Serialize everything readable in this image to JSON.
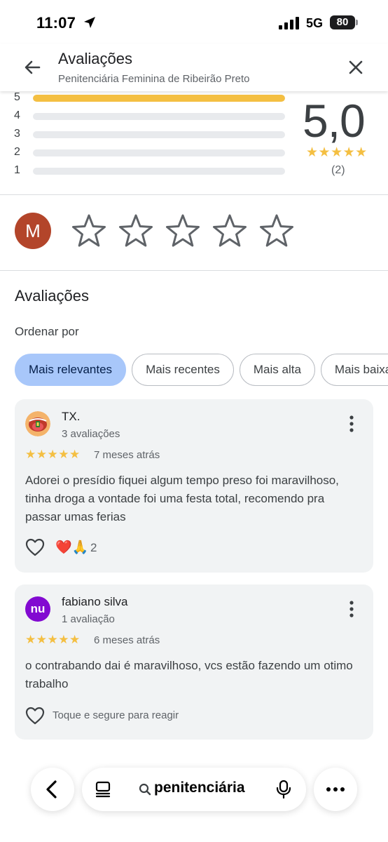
{
  "status_bar": {
    "time": "11:07",
    "network": "5G",
    "battery": "80"
  },
  "header": {
    "title": "Avaliações",
    "subtitle": "Penitenciária Feminina de Ribeirão Preto"
  },
  "rating_summary": {
    "average": "5,0",
    "stars": "★★★★★",
    "count": "(2)",
    "histogram": [
      {
        "label": "5",
        "fraction": 1.0
      },
      {
        "label": "4",
        "fraction": 0
      },
      {
        "label": "3",
        "fraction": 0
      },
      {
        "label": "2",
        "fraction": 0
      },
      {
        "label": "1",
        "fraction": 0
      }
    ]
  },
  "user": {
    "avatar_initial": "M",
    "avatar_color": "#b3452a"
  },
  "reviews_section": {
    "title": "Avaliações",
    "sort_label": "Ordenar por",
    "chips": [
      "Mais relevantes",
      "Mais recentes",
      "Mais alta",
      "Mais baixa"
    ]
  },
  "reviews": [
    {
      "name": "TX.",
      "review_count": "3 avaliações",
      "stars": "★★★★★",
      "time": "7 meses atrás",
      "text": "Adorei o presídio fiquei algum tempo preso foi maravilhoso, tinha droga a vontade foi uma festa total, recomendo pra passar umas ferias",
      "reactions": "❤️🙏",
      "reaction_count": "2"
    },
    {
      "name": "fabiano silva",
      "review_count": "1 avaliação",
      "stars": "★★★★★",
      "time": "6 meses atrás",
      "text": "o contrabando dai é maravilhoso, vcs estão fazendo um otimo trabalho",
      "react_hint": "Toque e segure para reagir",
      "avatar_text": "nu",
      "avatar_color": "#820ad1"
    }
  ],
  "browser": {
    "url_text": "penitenciária"
  },
  "colors": {
    "star": "#f4bf42",
    "active_chip": "#a8c7fa"
  }
}
